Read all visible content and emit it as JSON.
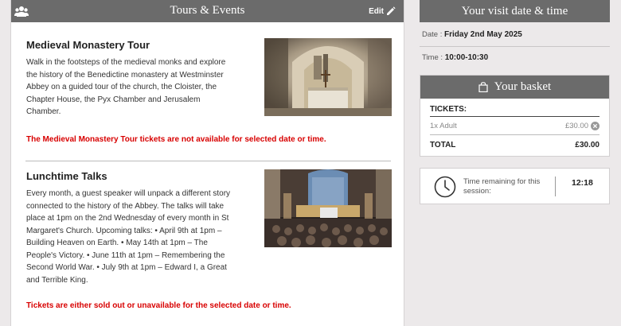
{
  "tours_panel": {
    "title": "Tours & Events",
    "edit_label": "Edit"
  },
  "events": [
    {
      "title": "Medieval Monastery Tour",
      "description": "Walk in the footsteps of the medieval monks and explore the history of the Benedictine monastery at Westminster Abbey on a guided tour of the church, the Cloister, the Chapter House, the Pyx Chamber and Jerusalem Chamber.",
      "availability": "The Medieval Monastery Tour tickets are not available for selected date or time."
    },
    {
      "title": "Lunchtime Talks",
      "description": "Every month, a guest speaker will unpack a different story connected to the history of the Abbey. The talks will take place at 1pm on the 2nd Wednesday of every month in St Margaret's Church. Upcoming talks: • April 9th at 1pm – Building Heaven on Earth. • May 14th at 1pm – The People's Victory. • June 11th at 1pm – Remembering the Second World War. • July 9th at 1pm – Edward I, a Great and Terrible King.",
      "availability": "Tickets are either sold out or unavailable for the selected date or time."
    }
  ],
  "visit": {
    "title": "Your visit date & time",
    "date_label": "Date :",
    "date_value": "Friday 2nd May 2025",
    "time_label": "Time :",
    "time_value": "10:00-10:30"
  },
  "basket": {
    "title": "Your basket",
    "tickets_heading": "TICKETS:",
    "items": [
      {
        "label": "1x Adult",
        "price": "£30.00"
      }
    ],
    "total_label": "TOTAL",
    "total_value": "£30.00"
  },
  "session_timer": {
    "label": "Time remaining for this session:",
    "value": "12:18"
  },
  "colors": {
    "header_bg": "#6b6b6b",
    "warning": "#d80000",
    "page_bg": "#ece9ea"
  }
}
